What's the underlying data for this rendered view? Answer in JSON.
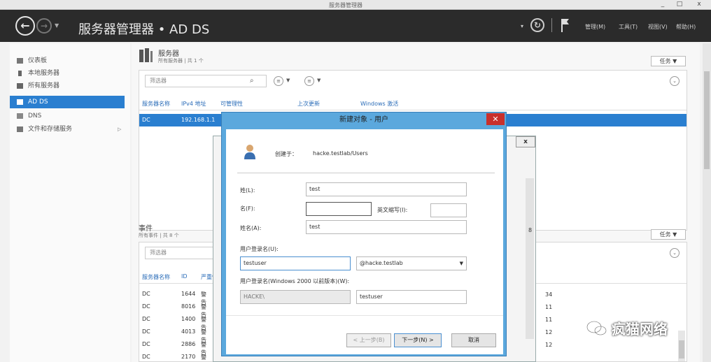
{
  "window": {
    "title": "服务器管理器",
    "min": "_",
    "max": "□",
    "close": "x"
  },
  "header": {
    "back_icon": "back-arrow-icon",
    "breadcrumb": "服务器管理器 • AD DS",
    "refresh_icon": "refresh-icon",
    "flag_icon": "notifications-flag-icon",
    "menus": [
      "管理(M)",
      "工具(T)",
      "视图(V)",
      "帮助(H)"
    ]
  },
  "nav": {
    "items": [
      {
        "label": "仪表板",
        "icon": "dashboard-icon",
        "selected": false
      },
      {
        "label": "本地服务器",
        "icon": "server-icon",
        "selected": false
      },
      {
        "label": "所有服务器",
        "icon": "servers-icon",
        "selected": false
      },
      {
        "label": "AD DS",
        "icon": "adds-icon",
        "selected": true
      },
      {
        "label": "DNS",
        "icon": "dns-icon",
        "selected": false
      },
      {
        "label": "文件和存储服务",
        "icon": "storage-icon",
        "selected": false,
        "expand": "▷"
      }
    ]
  },
  "servers": {
    "title": "服务器",
    "subtitle": "所有服务器 | 共 1 个",
    "tasks": "任务",
    "filter_placeholder": "筛选器",
    "columns": [
      "服务器名称",
      "IPv4 地址",
      "可管理性",
      "上次更新",
      "Windows 激活"
    ],
    "rows": [
      [
        "DC",
        "192.168.1.1"
      ]
    ]
  },
  "events": {
    "title": "事件",
    "subtitle": "所有事件 | 共 8 个",
    "tasks": "任务",
    "filter_placeholder": "筛选器",
    "columns": [
      "服务器名称",
      "ID",
      "严重性"
    ],
    "rows": [
      [
        "DC",
        "1644",
        "警告"
      ],
      [
        "DC",
        "8016",
        "警告"
      ],
      [
        "DC",
        "1400",
        "警告"
      ],
      [
        "DC",
        "4013",
        "警告"
      ],
      [
        "DC",
        "2886",
        "警告"
      ],
      [
        "DC",
        "2170",
        "警告"
      ]
    ],
    "right_col_values": [
      "34",
      "11",
      "11",
      "12",
      "12"
    ]
  },
  "bg_dialog": {
    "close": "x",
    "side_char": "8"
  },
  "dialog": {
    "title": "新建对象 - 用户",
    "create_in_label": "创建于：",
    "create_in_path": "hacke.testlab/Users",
    "first_name_label": "姓(L):",
    "first_name": "test",
    "initials_label": "名(F):",
    "initials": "",
    "middle_label": "英文缩写(I):",
    "middle": "",
    "full_name_label": "姓名(A):",
    "full_name": "test",
    "logon_label": "用户登录名(U):",
    "logon_name": "testuser",
    "domain": "@hacke.testlab",
    "pre2000_label": "用户登录名(Windows 2000 以前版本)(W):",
    "pre2000_domain": "HACKE\\",
    "pre2000_name": "testuser",
    "btn_back": "< 上一步(B)",
    "btn_next": "下一步(N) >",
    "btn_cancel": "取消"
  },
  "watermark": {
    "text": "疯猫网络",
    "icon": "wechat-icon"
  },
  "colors": {
    "header_bg": "#2b2b2b",
    "accent": "#2a7fd0",
    "dialog_frame": "#5ba8dd",
    "close_red": "#c9302c"
  }
}
